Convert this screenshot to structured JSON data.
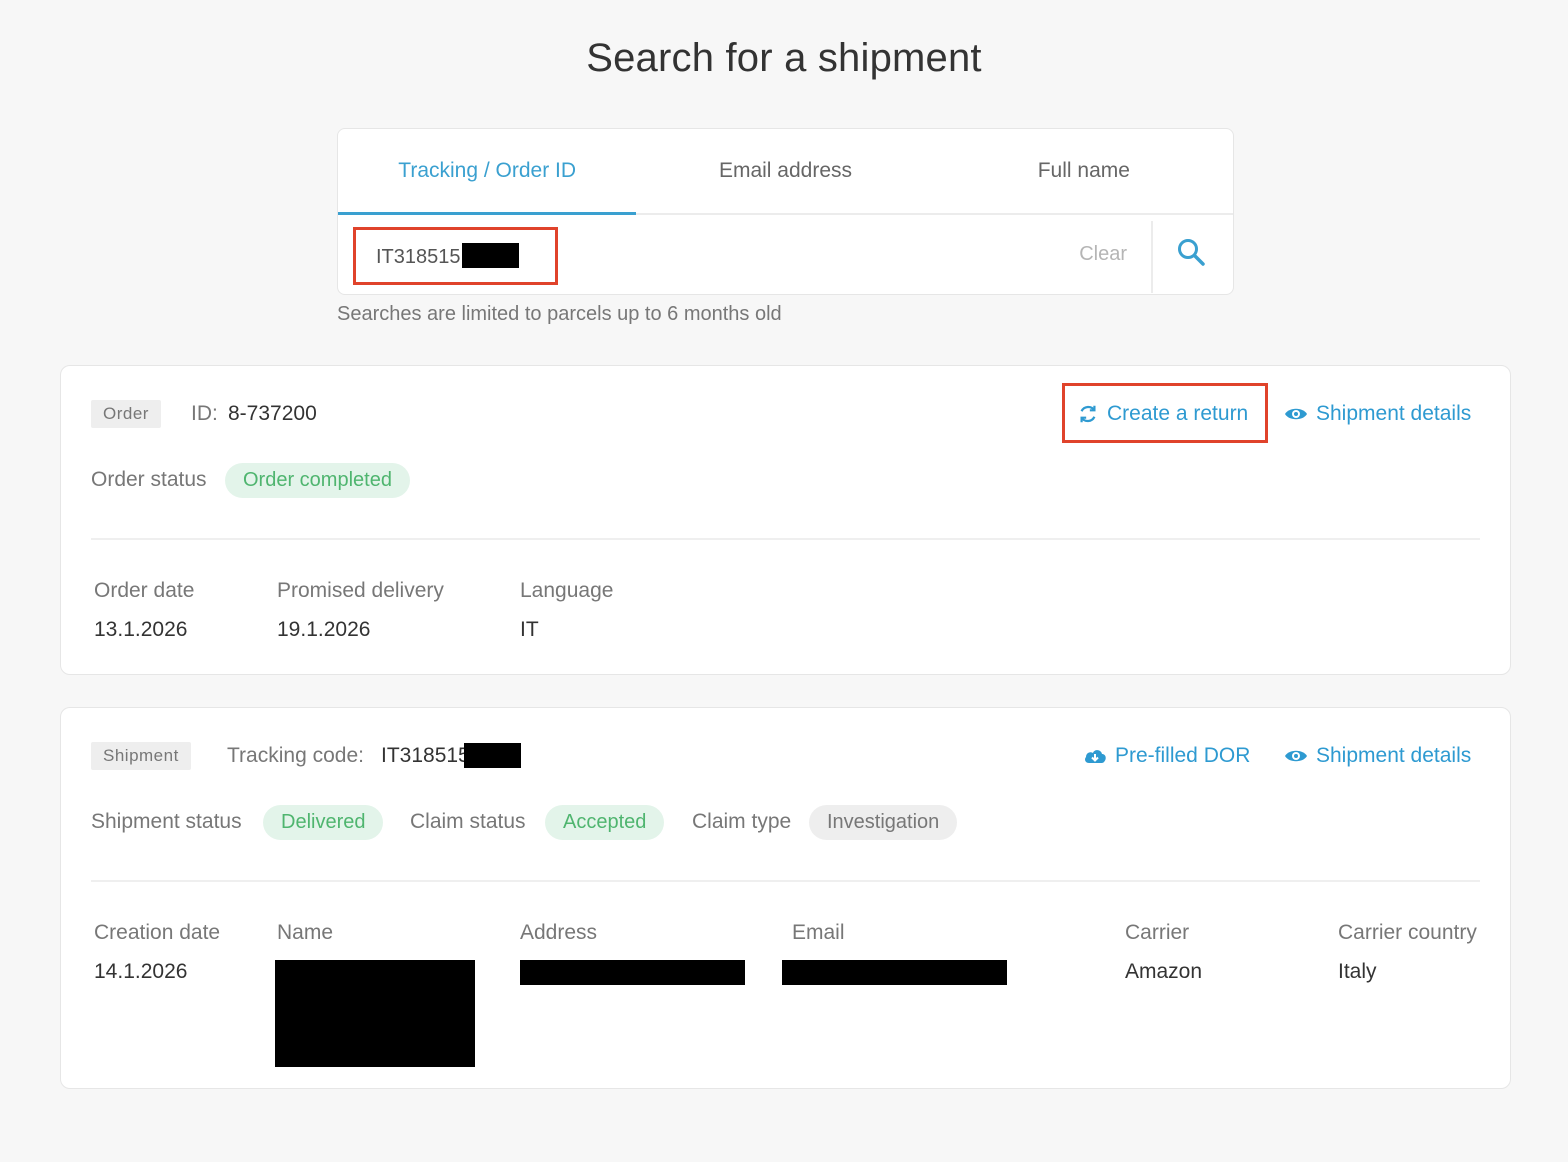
{
  "page": {
    "title": "Search for a shipment"
  },
  "search": {
    "tabs": [
      {
        "label": "Tracking / Order ID",
        "active": true
      },
      {
        "label": "Email address",
        "active": false
      },
      {
        "label": "Full name",
        "active": false
      }
    ],
    "value": "IT318515",
    "clear_label": "Clear",
    "hint": "Searches are limited to parcels up to 6 months old"
  },
  "order": {
    "tag": "Order",
    "id_label": "ID:",
    "id_value": "8-737200",
    "status_label": "Order status",
    "status_value": "Order completed",
    "actions": {
      "create_return": "Create a return",
      "shipment_details": "Shipment details"
    },
    "fields": [
      {
        "label": "Order date",
        "value": "13.1.2026"
      },
      {
        "label": "Promised delivery",
        "value": "19.1.2026"
      },
      {
        "label": "Language",
        "value": "IT"
      }
    ]
  },
  "shipment": {
    "tag": "Shipment",
    "tracking_label": "Tracking code:",
    "tracking_value": "IT318515",
    "actions": {
      "prefilled_dor": "Pre-filled DOR",
      "shipment_details": "Shipment details"
    },
    "status_label": "Shipment status",
    "status_value": "Delivered",
    "claim_status_label": "Claim status",
    "claim_status_value": "Accepted",
    "claim_type_label": "Claim type",
    "claim_type_value": "Investigation",
    "fields": [
      {
        "label": "Creation date",
        "value": "14.1.2026"
      },
      {
        "label": "Name",
        "value": ""
      },
      {
        "label": "Address",
        "value": ""
      },
      {
        "label": "Email",
        "value": ""
      },
      {
        "label": "Carrier",
        "value": "Amazon"
      },
      {
        "label": "Carrier country",
        "value": "Italy"
      }
    ]
  },
  "colors": {
    "accent": "#3aa0d0",
    "link": "#2e9ad1",
    "success_bg": "#e3f4ea",
    "success_text": "#4fb56f",
    "highlight": "#e0432b"
  }
}
